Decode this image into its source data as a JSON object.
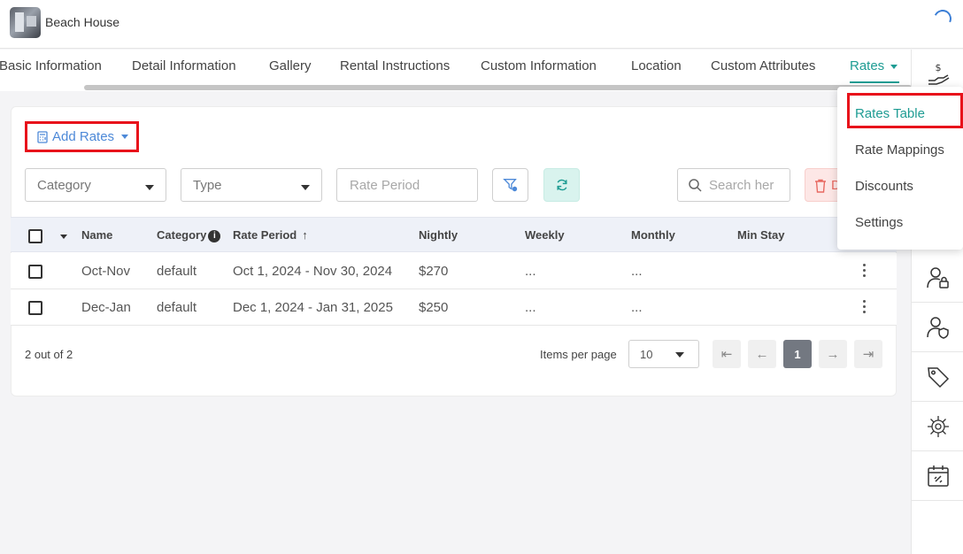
{
  "header": {
    "property_name": "Beach House"
  },
  "tabs": [
    {
      "label": "Basic Information"
    },
    {
      "label": "Detail Information"
    },
    {
      "label": "Gallery"
    },
    {
      "label": "Rental Instructions"
    },
    {
      "label": "Custom Information"
    },
    {
      "label": "Location"
    },
    {
      "label": "Custom Attributes"
    },
    {
      "label": "Rates",
      "active": true
    }
  ],
  "toolbar": {
    "add_rates_label": "Add Rates",
    "category_placeholder": "Category",
    "type_placeholder": "Type",
    "rate_period_placeholder": "Rate Period",
    "search_placeholder": "Search her",
    "delete_label": "D"
  },
  "table": {
    "columns": [
      "Name",
      "Category",
      "Rate Period",
      "Nightly",
      "Weekly",
      "Monthly",
      "Min Stay"
    ],
    "info_glyph": "i",
    "sort_glyph": "↑",
    "rows": [
      {
        "name": "Oct-Nov",
        "category": "default",
        "rate_period": "Oct 1, 2024 - Nov 30, 2024",
        "nightly": "$270",
        "weekly": "...",
        "monthly": "...",
        "min_stay": ""
      },
      {
        "name": "Dec-Jan",
        "category": "default",
        "rate_period": "Dec 1, 2024 - Jan 31, 2025",
        "nightly": "$250",
        "weekly": "...",
        "monthly": "...",
        "min_stay": ""
      }
    ]
  },
  "footer": {
    "count_text": "2 out of 2",
    "items_per_page_label": "Items per page",
    "items_per_page_value": "10",
    "first_glyph": "⇤",
    "prev_glyph": "←",
    "current_page": "1",
    "next_glyph": "→",
    "last_glyph": "⇥"
  },
  "rates_menu": {
    "items": [
      "Rates Table",
      "Rate Mappings",
      "Discounts",
      "Settings"
    ],
    "active": "Rates Table"
  },
  "rail": {
    "icons": [
      "rates-hand-dollar-icon",
      "user-lock-icon",
      "user-shield-icon",
      "tags-icon",
      "virus-gear-icon",
      "calendar-link-icon"
    ]
  },
  "colors": {
    "accent": "#1e9c93",
    "link": "#4d89d8",
    "highlight": "#e8121b"
  }
}
